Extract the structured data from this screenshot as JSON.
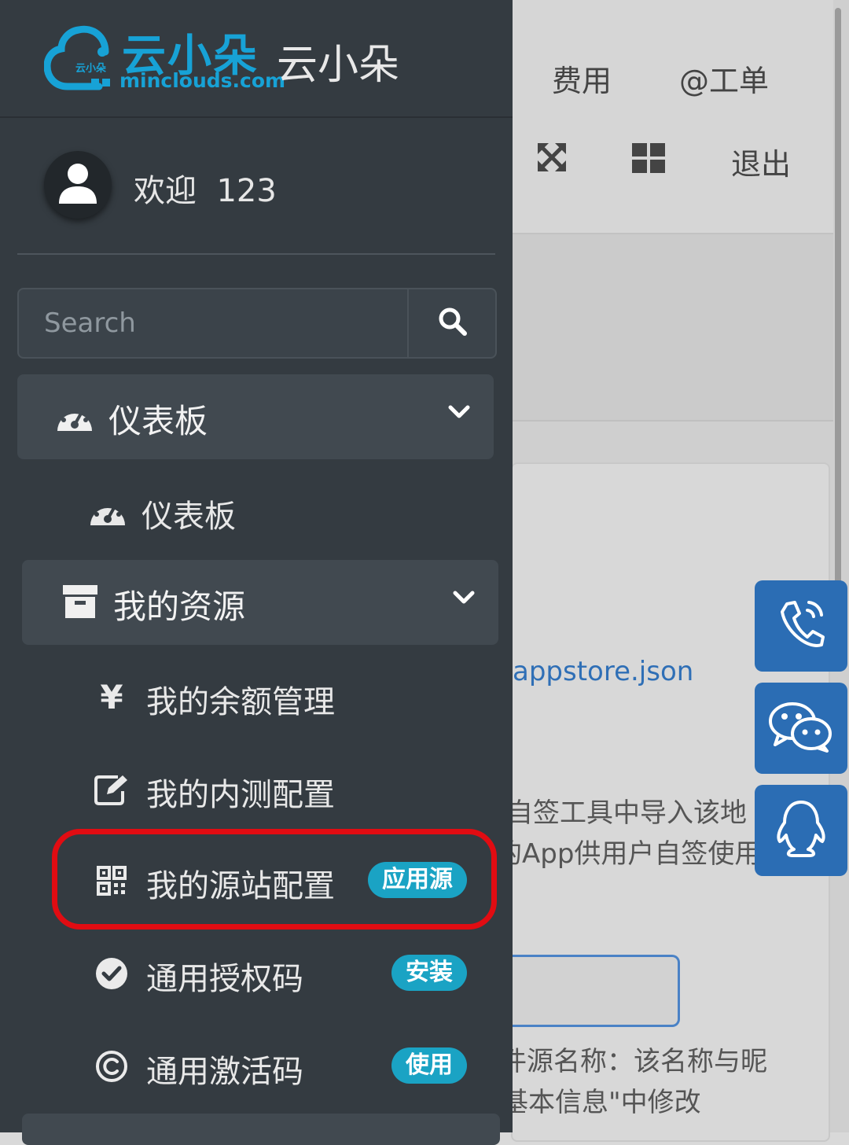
{
  "brand": {
    "logo_text": "云小朵",
    "logo_domain": "minclouds.com",
    "logo_small": "云小朵",
    "title": "云小朵"
  },
  "top_nav": {
    "fee_label": "费用",
    "ticket_label": "@工单",
    "logout_label": "退出",
    "fullscreen_icon": "expand-arrows-icon",
    "apps_icon": "grid-icon"
  },
  "user": {
    "welcome": "欢迎",
    "name": "123"
  },
  "search": {
    "placeholder": "Search"
  },
  "menu": {
    "dashboard_group": "仪表板",
    "dashboard_item": "仪表板",
    "resources_group": "我的资源",
    "items": [
      {
        "label": "我的余额管理",
        "icon": "yen-icon",
        "badge": ""
      },
      {
        "label": "我的内测配置",
        "icon": "edit-icon",
        "badge": ""
      },
      {
        "label": "我的源站配置",
        "icon": "qrcode-icon",
        "badge": "应用源"
      },
      {
        "label": "通用授权码",
        "icon": "check-circle-icon",
        "badge": "安装"
      },
      {
        "label": "通用激活码",
        "icon": "copyright-icon",
        "badge": "使用"
      }
    ]
  },
  "background": {
    "link_text": "appstore.json",
    "text_line1": "自签工具中导入该地",
    "text_line2": "的App供用户自签使用",
    "text_line3": "件源名称：该名称与昵",
    "text_line4": "基本信息\"中修改"
  },
  "colors": {
    "sidebar": "#343b41",
    "accent": "#17a2d6",
    "badge": "#1aa3c4",
    "highlight": "#e10c12",
    "float_button": "#2b6db4"
  }
}
